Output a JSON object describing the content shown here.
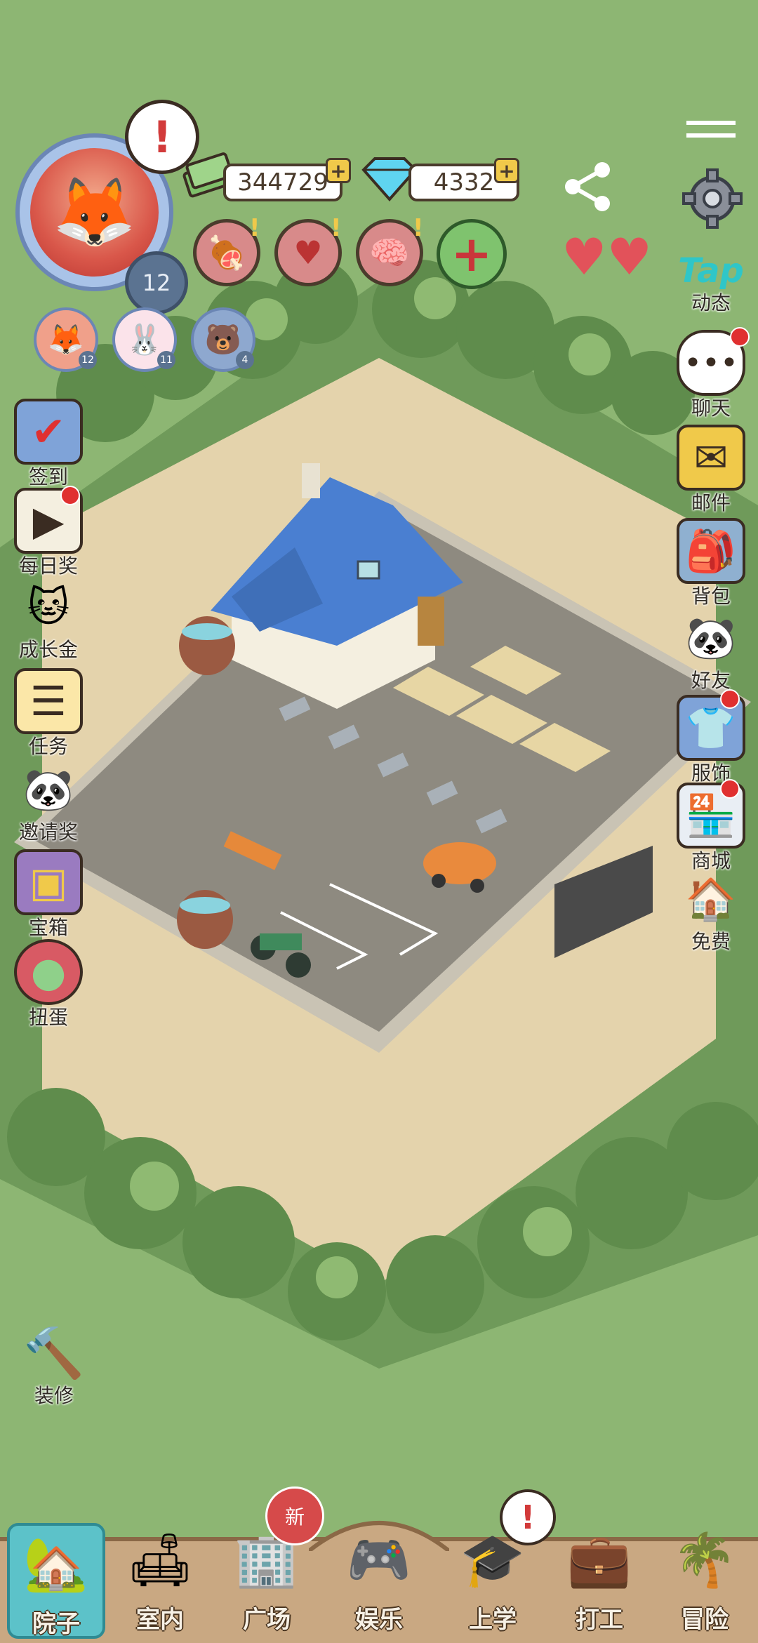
{
  "player": {
    "level": "12",
    "alert_mark": "!",
    "avatar_icon": "fox-with-sunglasses-icon"
  },
  "currency": {
    "coins": "344729",
    "diamonds": "4332",
    "plus": "+"
  },
  "stats": {
    "plus": "+",
    "alert_mark": "!"
  },
  "pets": {
    "levels": [
      "12",
      "11",
      "4"
    ]
  },
  "left_menu": [
    {
      "label": "签到",
      "icon": "checkin-calendar-icon"
    },
    {
      "label": "每日奖",
      "icon": "video-reward-icon"
    },
    {
      "label": "成长金",
      "icon": "growth-fund-icon"
    },
    {
      "label": "任务",
      "icon": "task-clipboard-icon"
    },
    {
      "label": "邀请奖",
      "icon": "invite-reward-icon"
    },
    {
      "label": "宝箱",
      "icon": "treasure-chest-icon"
    },
    {
      "label": "扭蛋",
      "icon": "gacha-machine-icon"
    }
  ],
  "right_menu": [
    {
      "label": "动态",
      "icon": "tap-icon",
      "brand": "Tap"
    },
    {
      "label": "聊天",
      "icon": "chat-bubble-icon"
    },
    {
      "label": "邮件",
      "icon": "mail-icon"
    },
    {
      "label": "背包",
      "icon": "backpack-icon"
    },
    {
      "label": "好友",
      "icon": "panda-friends-icon"
    },
    {
      "label": "服饰",
      "icon": "clothing-icon"
    },
    {
      "label": "商城",
      "icon": "shop-icon"
    },
    {
      "label": "免费",
      "icon": "free-house-icon"
    }
  ],
  "decorate": {
    "label": "装修",
    "icon": "hammer-icon"
  },
  "bottom_nav": [
    {
      "label": "院子",
      "icon": "yard-house-icon",
      "active": true
    },
    {
      "label": "室内",
      "icon": "indoor-sofa-icon"
    },
    {
      "label": "广场",
      "icon": "plaza-building-icon",
      "badge": "新"
    },
    {
      "label": "娱乐",
      "icon": "gamepad-icon"
    },
    {
      "label": "上学",
      "icon": "graduation-cap-icon",
      "alert": "!"
    },
    {
      "label": "打工",
      "icon": "briefcase-icon"
    },
    {
      "label": "冒险",
      "icon": "palm-tree-icon"
    }
  ],
  "colors": {
    "grass": "#8db673",
    "sand": "#e4d3ac",
    "roof": "#4a7fd1",
    "accent_teal": "#5cc2c9",
    "alert_red": "#e03030"
  }
}
